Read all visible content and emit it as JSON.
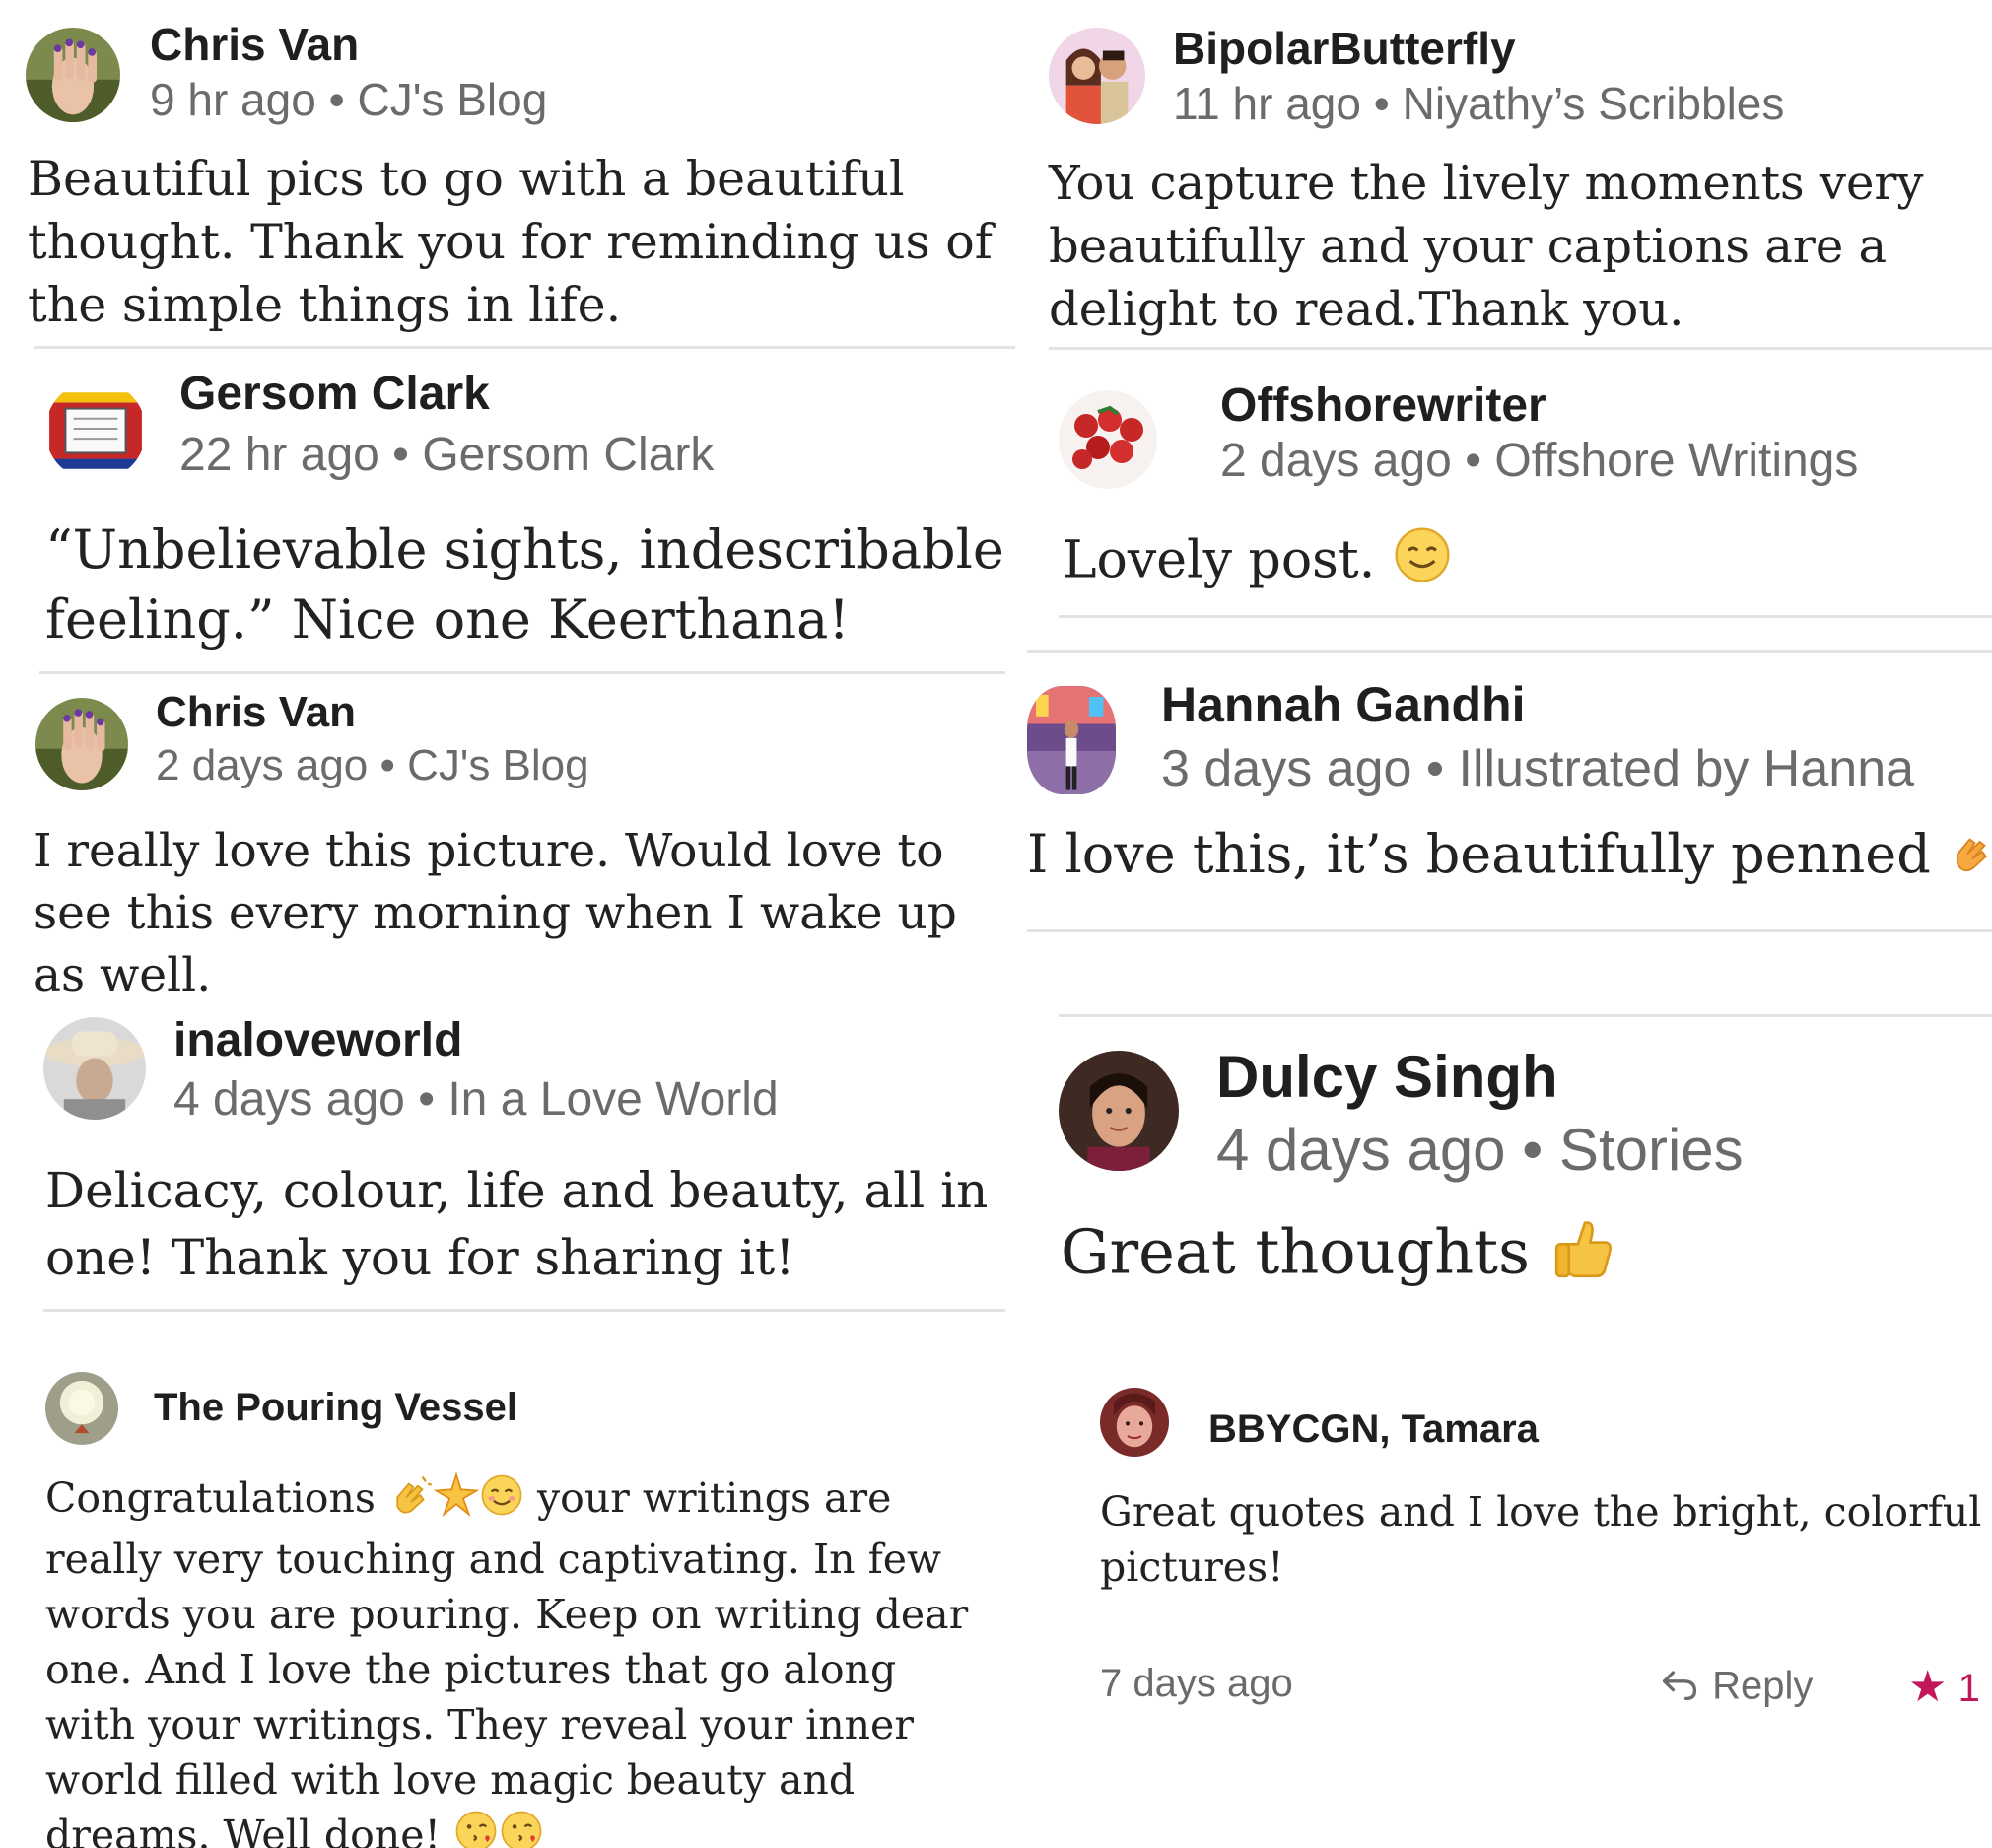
{
  "left": {
    "comments": [
      {
        "author": "Chris Van",
        "time": "9 hr ago",
        "blog": "CJ's Blog",
        "body": "Beautiful pics to go with a beautiful thought. Thank you for reminding us of the simple things in life."
      },
      {
        "author": "Gersom Clark",
        "time": "22 hr ago",
        "blog": "Gersom Clark",
        "body": "“Unbelievable sights, indescribable feeling.” Nice one Keerthana!"
      },
      {
        "author": "Chris Van",
        "time": "2 days ago",
        "blog": "CJ's Blog",
        "body": "I really love this picture. Would love to see this every morning when I wake up as well."
      },
      {
        "author": "inaloveworld",
        "time": "4 days ago",
        "blog": "In a Love World",
        "body": "Delicacy, colour, life and beauty, all in one! Thank you for sharing it!"
      },
      {
        "author": "The Pouring Vessel",
        "body_start": "Congratulations",
        "body": "your writings are really very touching and captivating. In few words you are pouring. Keep on writing dear one. And I love the pictures that go along with your writings. They reveal your inner world filled with love magic beauty and dreams. Well done!"
      }
    ]
  },
  "right": {
    "comments": [
      {
        "author": "BipolarButterfly",
        "time": "11 hr ago",
        "blog": "Niyathy’s Scribbles",
        "body": "You capture the lively moments very beautifully and your captions are a delight to read.Thank you."
      },
      {
        "author": "Offshorewriter",
        "time": "2 days ago",
        "blog": "Offshore Writings",
        "body": "Lovely post."
      },
      {
        "author": "Hannah Gandhi",
        "time": "3 days ago",
        "blog": "Illustrated by Hanna",
        "body": "I love this, it’s beautifully penned"
      },
      {
        "author": "Dulcy Singh",
        "time": "4 days ago",
        "blog": "Stories",
        "body": "Great thoughts"
      },
      {
        "author": "BBYCGN, Tamara",
        "body": "Great quotes and I love the bright, colorful pictures!",
        "time": "7 days ago",
        "reply_label": "Reply",
        "like_count": "1"
      }
    ]
  },
  "separator": "•",
  "icons": {
    "smile": "smiling-face-icon",
    "thumbs_up": "thumbs-up-icon",
    "clap": "clapping-hands-icon",
    "sparkle": "sparkle-icon",
    "blush": "blushing-face-icon",
    "kiss": "kissing-face-icon",
    "reply": "reply-arrow-icon",
    "star": "star-icon"
  },
  "colors": {
    "star": "#c2185b",
    "divider": "#e3e3e3",
    "meta_text": "#6b6b6b"
  }
}
